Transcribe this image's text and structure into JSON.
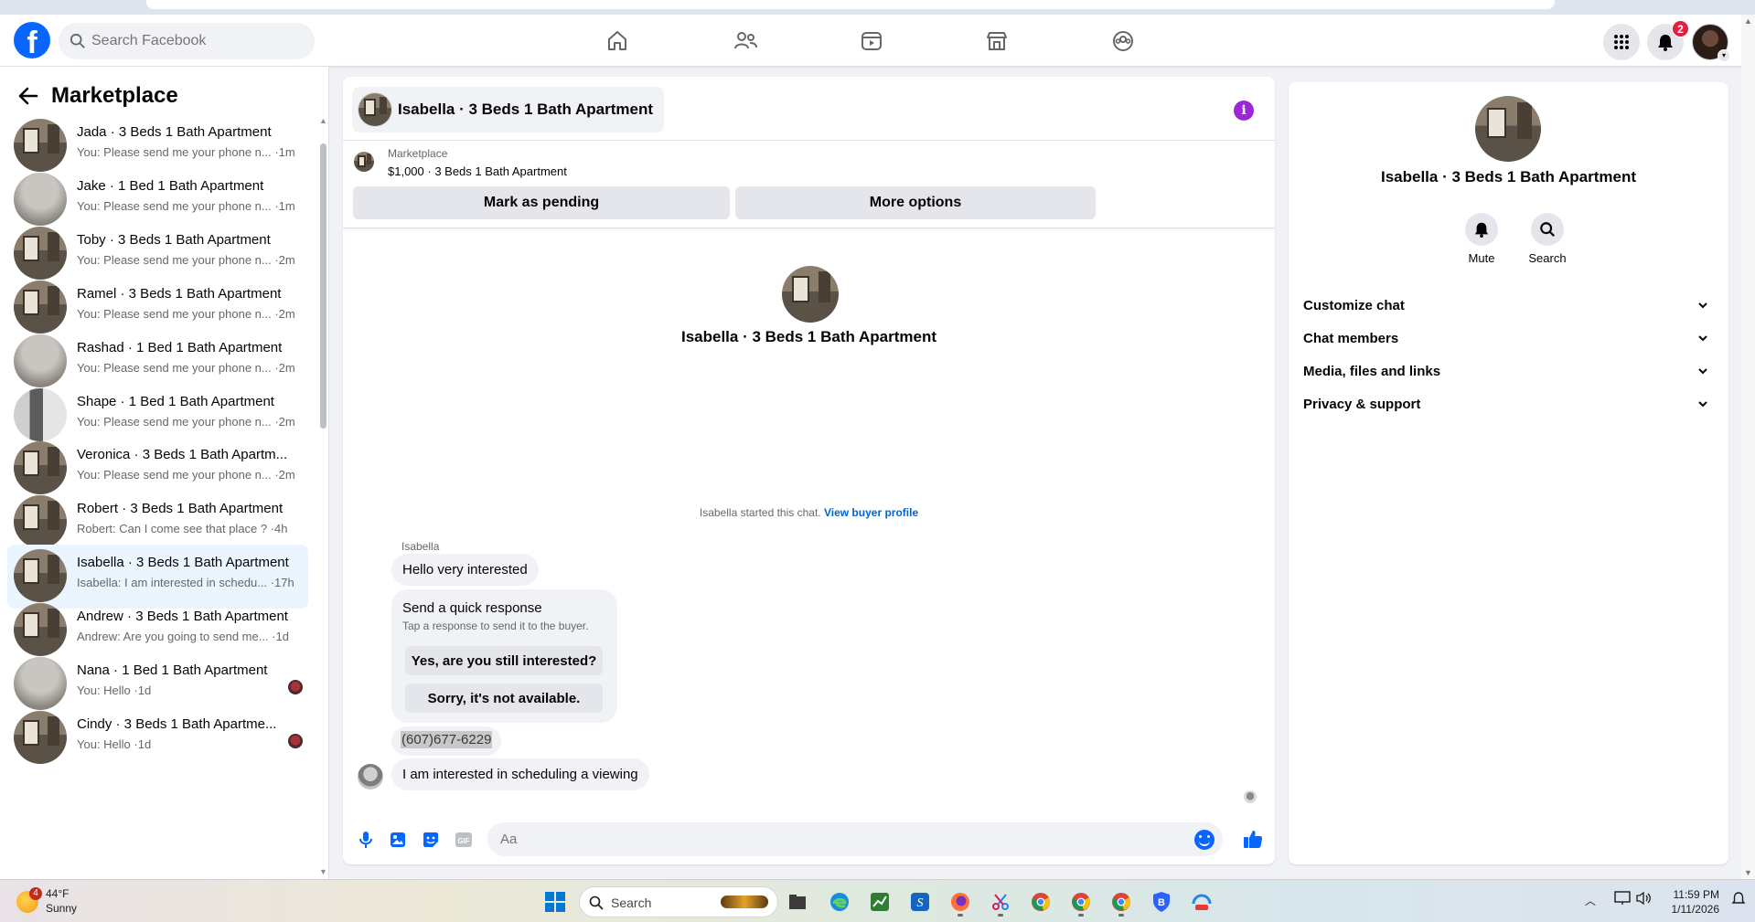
{
  "nav": {
    "search_placeholder": "Search Facebook",
    "notification_count": "2",
    "icons": [
      "home-icon",
      "friends-icon",
      "watch-icon",
      "marketplace-icon",
      "groups-icon"
    ]
  },
  "sidebar": {
    "title": "Marketplace",
    "conversations": [
      {
        "name": "Jada · 3 Beds 1 Bath Apartment",
        "snippet": "You: Please send me your phone n... ·1m",
        "thumb": "room",
        "unread": false
      },
      {
        "name": "Jake · 1 Bed 1 Bath Apartment",
        "snippet": "You: Please send me your phone n... ·1m",
        "thumb": "gray",
        "unread": false
      },
      {
        "name": "Toby · 3 Beds 1 Bath Apartment",
        "snippet": "You: Please send me your phone n... ·2m",
        "thumb": "room",
        "unread": false
      },
      {
        "name": "Ramel · 3 Beds 1 Bath Apartment",
        "snippet": "You: Please send me your phone n... ·2m",
        "thumb": "room",
        "unread": false
      },
      {
        "name": "Rashad · 1 Bed 1 Bath Apartment",
        "snippet": "You: Please send me your phone n... ·2m",
        "thumb": "gray",
        "unread": false
      },
      {
        "name": "Shape · 1 Bed 1 Bath Apartment",
        "snippet": "You: Please send me your phone n... ·2m",
        "thumb": "kitchen",
        "unread": false
      },
      {
        "name": "Veronica · 3 Beds 1 Bath Apartm...",
        "snippet": "You: Please send me your phone n... ·2m",
        "thumb": "room",
        "unread": false
      },
      {
        "name": "Robert · 3 Beds 1 Bath Apartment",
        "snippet": "Robert: Can I come see that place ? ·4h",
        "thumb": "room",
        "unread": false
      },
      {
        "name": "Isabella · 3 Beds 1 Bath Apartment",
        "snippet": "Isabella: I am interested in schedu... ·17h",
        "thumb": "room",
        "unread": false,
        "active": true
      },
      {
        "name": "Andrew · 3 Beds 1 Bath Apartment",
        "snippet": "Andrew: Are you going to send me... ·1d",
        "thumb": "room",
        "unread": false
      },
      {
        "name": "Nana · 1 Bed 1 Bath Apartment",
        "snippet": "You: Hello ·1d",
        "thumb": "gray",
        "unread": true
      },
      {
        "name": "Cindy · 3 Beds 1 Bath Apartme...",
        "snippet": "You: Hello ·1d",
        "thumb": "room",
        "unread": true
      }
    ]
  },
  "chat": {
    "title": "Isabella · 3 Beds 1 Bath Apartment",
    "listing_source": "Marketplace",
    "listing_price": "$1,000 · 3 Beds 1 Bath Apartment",
    "mark_pending_label": "Mark as pending",
    "more_options_label": "More options",
    "center_name": "Isabella · 3 Beds 1 Bath Apartment",
    "started_text": "Isabella started this chat.",
    "view_profile_link": "View buyer profile",
    "sender_name": "Isabella",
    "messages": {
      "first": "Hello very interested",
      "quick_title": "Send a quick response",
      "quick_subtitle": "Tap a response to send it to the buyer.",
      "quick_option_1": "Yes, are you still interested?",
      "quick_option_2": "Sorry, it's not available.",
      "phone": "(607)677-6229",
      "last": "I am interested in scheduling a viewing"
    },
    "composer_placeholder": "Aa"
  },
  "right_panel": {
    "title": "Isabella · 3 Beds 1 Bath Apartment",
    "mute_label": "Mute",
    "search_label": "Search",
    "sections": [
      "Customize chat",
      "Chat members",
      "Media, files and links",
      "Privacy & support"
    ]
  },
  "taskbar": {
    "weather_temp": "44°F",
    "weather_cond": "Sunny",
    "weather_badge": "4",
    "search_placeholder": "Search",
    "time": "11:59 PM",
    "date": "1/11/2026"
  },
  "colors": {
    "brand": "#0866ff",
    "active_row": "#ebf5ff",
    "info_purple": "#9b27d8",
    "badge_red": "#e41e3f"
  }
}
